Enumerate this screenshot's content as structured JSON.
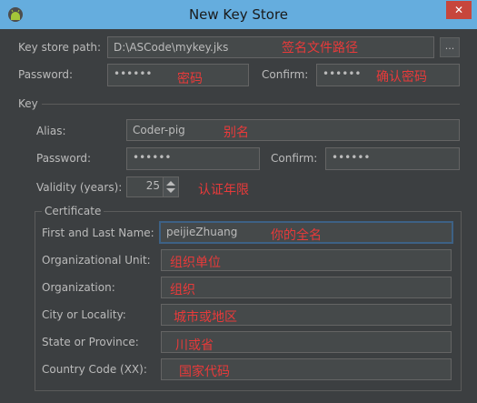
{
  "window": {
    "title": "New Key Store",
    "close_glyph": "✕",
    "icon": "android-icon"
  },
  "keystore": {
    "path_label": "Key store path:",
    "path_value": "D:\\ASCode\\mykey.jks",
    "path_note": "签名文件路径",
    "browse_label": "...",
    "password_label": "Password:",
    "password_value": "••••••",
    "password_note": "密码",
    "confirm_label": "Confirm:",
    "confirm_value": "••••••",
    "confirm_note": "确认密码"
  },
  "key": {
    "section_label": "Key",
    "alias_label": "Alias:",
    "alias_value": "Coder-pig",
    "alias_note": "别名",
    "password_label": "Password:",
    "password_value": "••••••",
    "confirm_label": "Confirm:",
    "confirm_value": "••••••",
    "validity_label": "Validity (years):",
    "validity_value": "25",
    "validity_note": "认证年限"
  },
  "certificate": {
    "section_label": "Certificate",
    "name_label": "First and Last Name:",
    "name_value": "peijieZhuang",
    "name_note": "你的全名",
    "org_unit_label": "Organizational Unit:",
    "org_unit_note": "组织单位",
    "org_label": "Organization:",
    "org_note": "组织",
    "city_label": "City or Locality:",
    "city_note": "城市或地区",
    "state_label": "State or Province:",
    "state_note": "川或省",
    "country_label": "Country Code (XX):",
    "country_note": "国家代码"
  },
  "colors": {
    "titlebar": "#65adde",
    "background": "#3c3f41",
    "annotation": "#e83a3a",
    "close": "#c7463c"
  }
}
